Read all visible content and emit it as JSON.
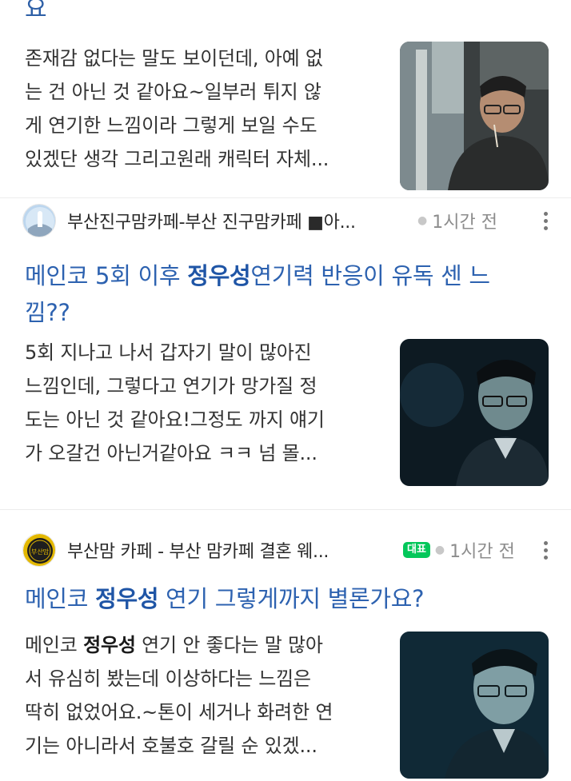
{
  "top_fragment": "요",
  "posts": [
    {
      "snippet_lines": [
        "존재감 없다는 말도 보이던데, 아예 없",
        "는 건 아닌 것 같아요~일부러 튀지 않",
        "게 연기한 느낌이라 그렇게 보일 수도",
        "있겠단 생각 그리고원래 캐릭터 자체..."
      ]
    },
    {
      "source": "부산진구맘카페-부산 진구맘카페 ■아...",
      "time": "1시간 전",
      "title_pre": "메인코 5회 이후 ",
      "title_bold": "정우성",
      "title_post_line1": "연기력 반응이 유독 센 느",
      "title_line2": "낌??",
      "snippet_lines": [
        "5회 지나고 나서 갑자기 말이 많아진",
        "느낌인데, 그렇다고 연기가 망가질 정",
        "도는 아닌 것 같아요!그정도 까지 얘기",
        "가 오갈건 아닌거같아요 ㅋㅋ 넘 몰..."
      ]
    },
    {
      "source": "부산맘 카페 - 부산 맘카페 결혼 웨...",
      "badge": "대표",
      "time": "1시간 전",
      "avatar_text": "부산맘",
      "title_pre": "메인코 ",
      "title_bold": "정우성",
      "title_post_line1": " 연기 그렇게까지 별론가요?",
      "snippet_line1_pre": "메인코 ",
      "snippet_line1_bold": "정우성",
      "snippet_line1_post": " 연기 안 좋다는 말 많아",
      "snippet_lines_rest": [
        "서 유심히 봤는데 이상하다는 느낌은",
        "딱히 없었어요.~톤이 세거나 화려한 연",
        "기는 아니라서 호불호 갈릴 순 있겠..."
      ]
    }
  ],
  "colors": {
    "title_blue": "#2d62b0",
    "badge_green": "#03c75a"
  }
}
